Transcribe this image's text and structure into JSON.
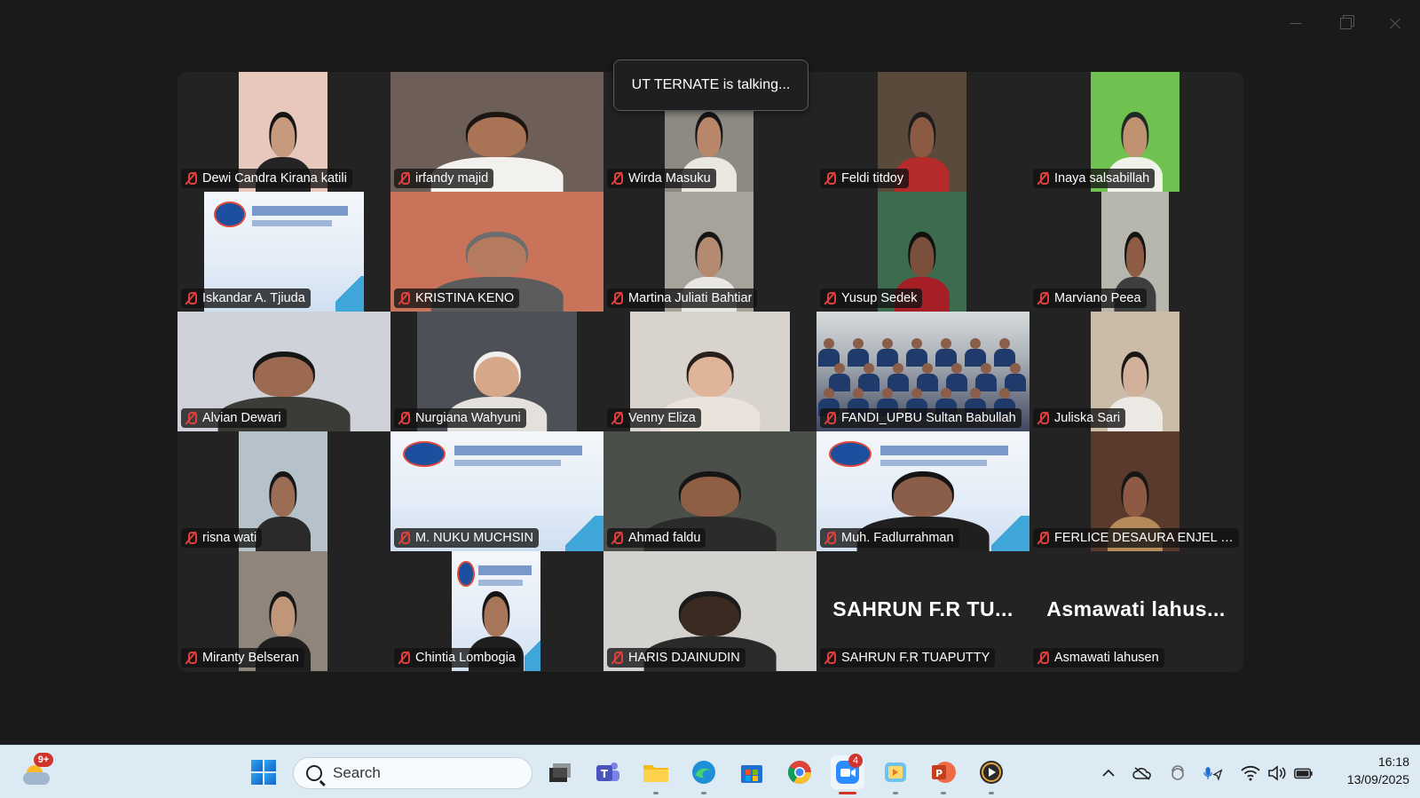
{
  "window": {
    "controls": [
      "minimize",
      "restore",
      "close"
    ]
  },
  "speaker_notice": "UT TERNATE is talking...",
  "participants": [
    {
      "name": "Dewi Candra Kirana katili",
      "video": "person",
      "skin": "#c79a7d",
      "hair": "#151515",
      "shirt": "#242424",
      "bg": "#e8c8bd",
      "vw": 100,
      "vx": 69
    },
    {
      "name": "irfandy majid",
      "video": "person",
      "skin": "#a97355",
      "hair": "#1b1612",
      "shirt": "#f3f1ee",
      "bg": "#6d5f57",
      "vw": 240,
      "vx": 0
    },
    {
      "name": "Wirda Masuku",
      "video": "person",
      "skin": "#b8876a",
      "hair": "#161616",
      "shirt": "#eae6e0",
      "bg": "#8d8a83",
      "vw": 100,
      "vx": 69
    },
    {
      "name": "Feldi titdoy",
      "video": "person",
      "skin": "#8a5a43",
      "hair": "#1c1c1c",
      "shirt": "#b52a2a",
      "bg": "#5a4a3c",
      "vw": 100,
      "vx": 69
    },
    {
      "name": "Inaya salsabillah",
      "video": "person",
      "skin": "#c09272",
      "hair": "#1f2a22",
      "shirt": "#eef2e8",
      "bg": "#6fc24f",
      "vw": 100,
      "vx": 69
    },
    {
      "name": "Iskandar A. Tjiuda",
      "video": "slide",
      "vw": 180,
      "vx": 30
    },
    {
      "name": "KRISTINA KENO",
      "video": "person",
      "skin": "#b47b5e",
      "hair": "#6b6e6c",
      "shirt": "#5c5c5c",
      "bg": "#c9735a",
      "vw": 240,
      "vx": 0
    },
    {
      "name": "Martina Juliati Bahtiar",
      "video": "person",
      "skin": "#b48b70",
      "hair": "#161616",
      "shirt": "#e9e7e4",
      "bg": "#a7a29a",
      "vw": 100,
      "vx": 69
    },
    {
      "name": "Yusup Sedek",
      "video": "person",
      "skin": "#7a4f3c",
      "hair": "#111",
      "shirt": "#a71f26",
      "bg": "#3c6b4e",
      "vw": 100,
      "vx": 69
    },
    {
      "name": "Marviano Peea",
      "video": "person",
      "skin": "#8e5c44",
      "hair": "#141414",
      "shirt": "#3c3f3e",
      "bg": "#b8b7ae",
      "vw": 76,
      "vx": 81
    },
    {
      "name": "Alvian Dewari",
      "video": "person",
      "skin": "#9b6a50",
      "hair": "#161616",
      "shirt": "#3b3b38",
      "bg": "#cfd2d8",
      "vw": 240,
      "vx": 0
    },
    {
      "name": "Nurgiana Wahyuni",
      "video": "person",
      "skin": "#d6a788",
      "hair": "#f1efeb",
      "shirt": "#e4e1dc",
      "bg": "#4d5157",
      "vw": 180,
      "vx": 30
    },
    {
      "name": "Venny Eliza",
      "video": "person",
      "skin": "#e0b498",
      "hair": "#2a1f1a",
      "shirt": "#e9e3dc",
      "bg": "#d8d4cd",
      "vw": 180,
      "vx": 30
    },
    {
      "name": "FANDI_UPBU Sultan Babullah",
      "video": "group",
      "vw": 240,
      "vx": 0
    },
    {
      "name": "Juliska Sari",
      "video": "person",
      "skin": "#d3b09a",
      "hair": "#1b1714",
      "shirt": "#ece8e3",
      "bg": "#cabca8",
      "vw": 100,
      "vx": 69
    },
    {
      "name": "risna wati",
      "video": "person",
      "skin": "#9b6d55",
      "hair": "#161616",
      "shirt": "#2a2a2a",
      "bg": "#b6c2c9",
      "vw": 100,
      "vx": 69
    },
    {
      "name": "M. NUKU MUCHSIN",
      "video": "slide",
      "vw": 240,
      "vx": 0
    },
    {
      "name": "Ahmad faldu",
      "video": "person",
      "skin": "#8e5e45",
      "hair": "#151515",
      "shirt": "#2b2b2b",
      "bg": "#4b4f49",
      "vw": 240,
      "vx": 0
    },
    {
      "name": "Muh. Fadlurrahman",
      "video": "slide-person",
      "skin": "#8a5e48",
      "hair": "#141414",
      "shirt": "#1f1f1f",
      "vw": 240,
      "vx": 0
    },
    {
      "name": "FERLICE DESAURA ENJEL LOSTUN",
      "video": "person",
      "skin": "#8e5a44",
      "hair": "#161616",
      "shirt": "#b78a5c",
      "bg": "#5a3a2c",
      "vw": 100,
      "vx": 69
    },
    {
      "name": "Miranty Belseran",
      "video": "person",
      "skin": "#c09679",
      "hair": "#161616",
      "shirt": "#1f1f1f",
      "bg": "#8f857b",
      "vw": 100,
      "vx": 69
    },
    {
      "name": "Chintia Lombogia",
      "video": "slide-person",
      "skin": "#a77559",
      "hair": "#141414",
      "shirt": "#1f1f1f",
      "vw": 100,
      "vx": 69
    },
    {
      "name": "HARIS DJAINUDIN",
      "video": "person",
      "skin": "#3a2a22",
      "hair": "#1a1a1a",
      "shirt": "#2a2a2a",
      "bg": "#d4d2cf",
      "vw": 240,
      "vx": 0
    },
    {
      "name": "SAHRUN F.R TUAPUTTY",
      "video": "none",
      "big": "SAHRUN F.R TU..."
    },
    {
      "name": "Asmawati lahusen",
      "video": "none",
      "big": "Asmawati  lahus..."
    }
  ],
  "taskbar": {
    "weather_badge": "9+",
    "search_placeholder": "Search",
    "zoom_badge": "4",
    "time": "16:18",
    "date": "13/09/2025"
  }
}
